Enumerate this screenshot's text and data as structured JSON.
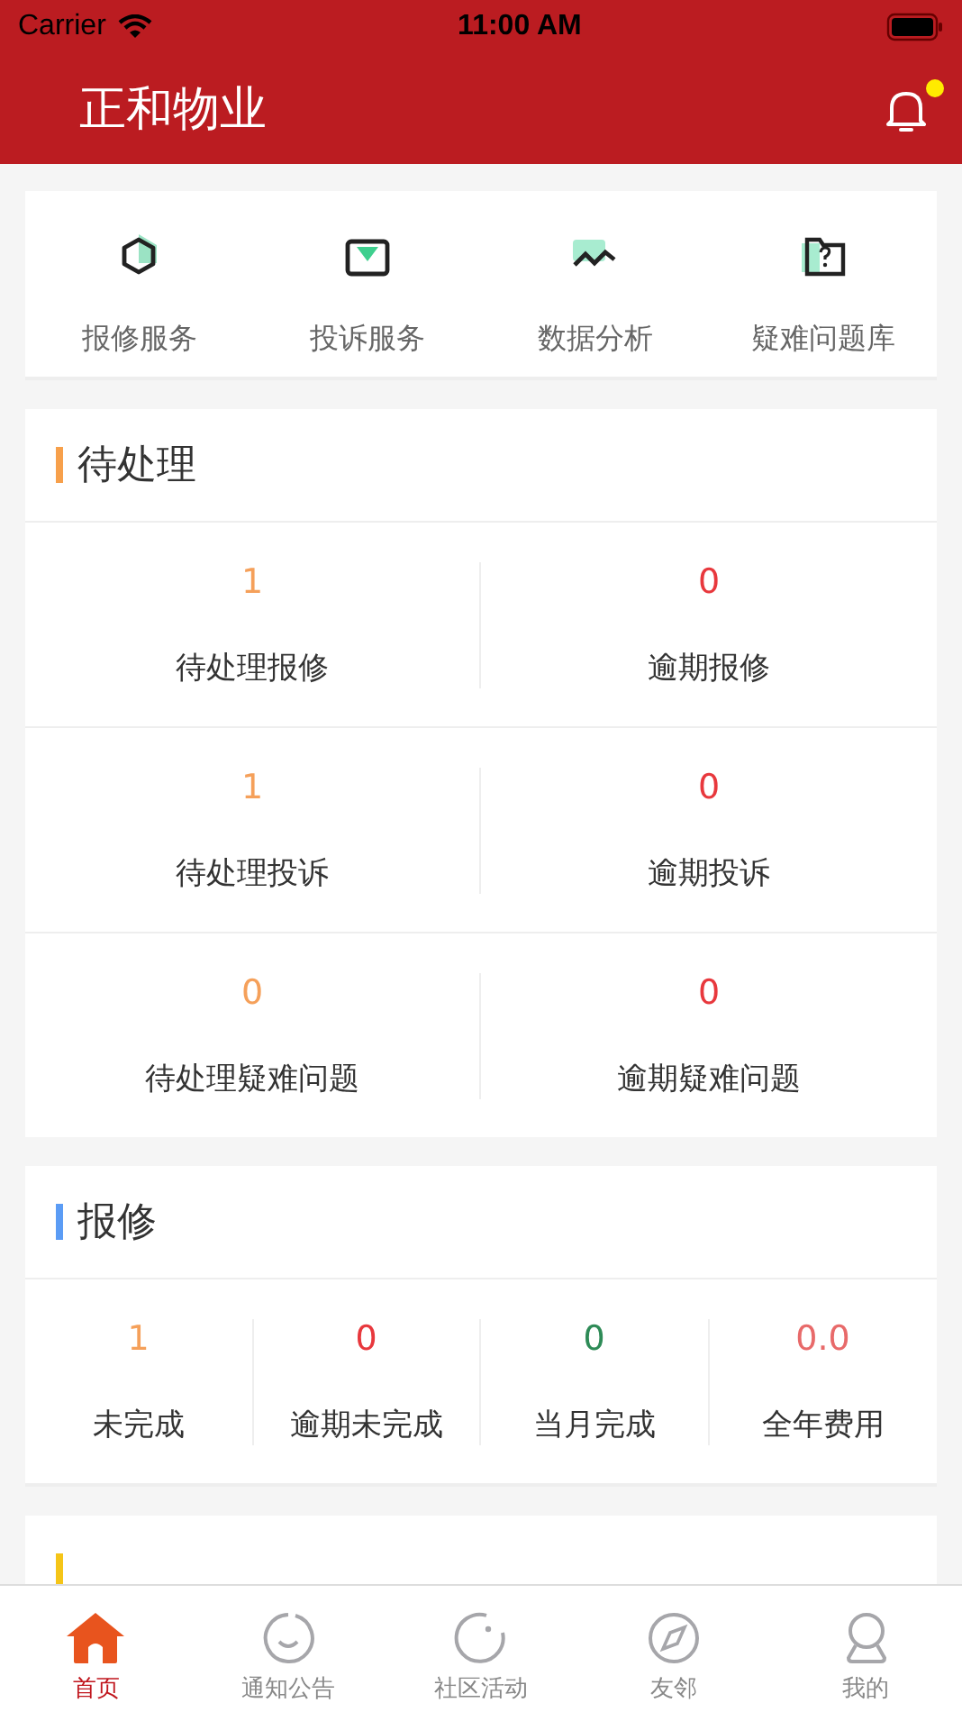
{
  "status_bar": {
    "carrier": "Carrier",
    "time": "11:00 AM"
  },
  "header": {
    "title": "正和物业",
    "notification_badge": true
  },
  "services": [
    {
      "kind": "repair",
      "label": "报修服务"
    },
    {
      "kind": "complaint",
      "label": "投诉服务"
    },
    {
      "kind": "analysis",
      "label": "数据分析"
    },
    {
      "kind": "faq",
      "label": "疑难问题库"
    }
  ],
  "pending": {
    "title": "待处理",
    "color": "#f7a04b",
    "items": [
      {
        "value": "1",
        "label": "待处理报修",
        "color": "#f5a05a"
      },
      {
        "value": "0",
        "label": "逾期报修",
        "color": "#e8383d"
      },
      {
        "value": "1",
        "label": "待处理投诉",
        "color": "#f5a05a"
      },
      {
        "value": "0",
        "label": "逾期投诉",
        "color": "#e8383d"
      },
      {
        "value": "0",
        "label": "待处理疑难问题",
        "color": "#f5a05a"
      },
      {
        "value": "0",
        "label": "逾期疑难问题",
        "color": "#e8383d"
      }
    ]
  },
  "repair": {
    "title": "报修",
    "color": "#5b9cf5",
    "items": [
      {
        "value": "1",
        "label": "未完成",
        "color": "#f5a05a"
      },
      {
        "value": "0",
        "label": "逾期未完成",
        "color": "#e8383d"
      },
      {
        "value": "0",
        "label": "当月完成",
        "color": "#2e8b57"
      },
      {
        "value": "0.0",
        "label": "全年费用",
        "color": "#e86a6a"
      }
    ]
  },
  "complaint": {
    "color": "#f5c518"
  },
  "tab_bar": [
    {
      "kind": "home",
      "label": "首页",
      "selected": true
    },
    {
      "kind": "smile",
      "label": "通知公告",
      "selected": false
    },
    {
      "kind": "circle",
      "label": "社区活动",
      "selected": false
    },
    {
      "kind": "compass",
      "label": "友邻",
      "selected": false
    },
    {
      "kind": "person",
      "label": "我的",
      "selected": false
    }
  ]
}
